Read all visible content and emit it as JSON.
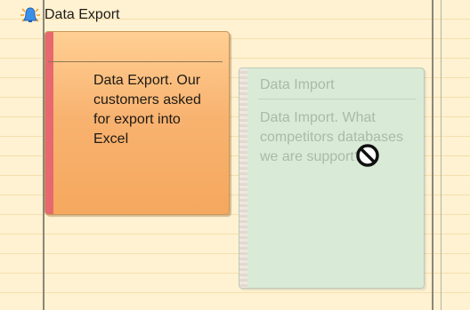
{
  "calendar": {
    "notes": [
      {
        "title": "Data Export",
        "body": "Data Export. Our customers asked for export into Excel"
      },
      {
        "title": "Data Import",
        "body": "Data Import. What competitors databases we are support?"
      }
    ]
  },
  "icons": {
    "reminder": "reminder-bell-icon",
    "drop_state": "no-entry-icon"
  },
  "colors": {
    "background": "#fff2d2",
    "export_note": "#f8b26f",
    "export_accent": "#e7686e",
    "import_note": "#d8ebd7"
  }
}
